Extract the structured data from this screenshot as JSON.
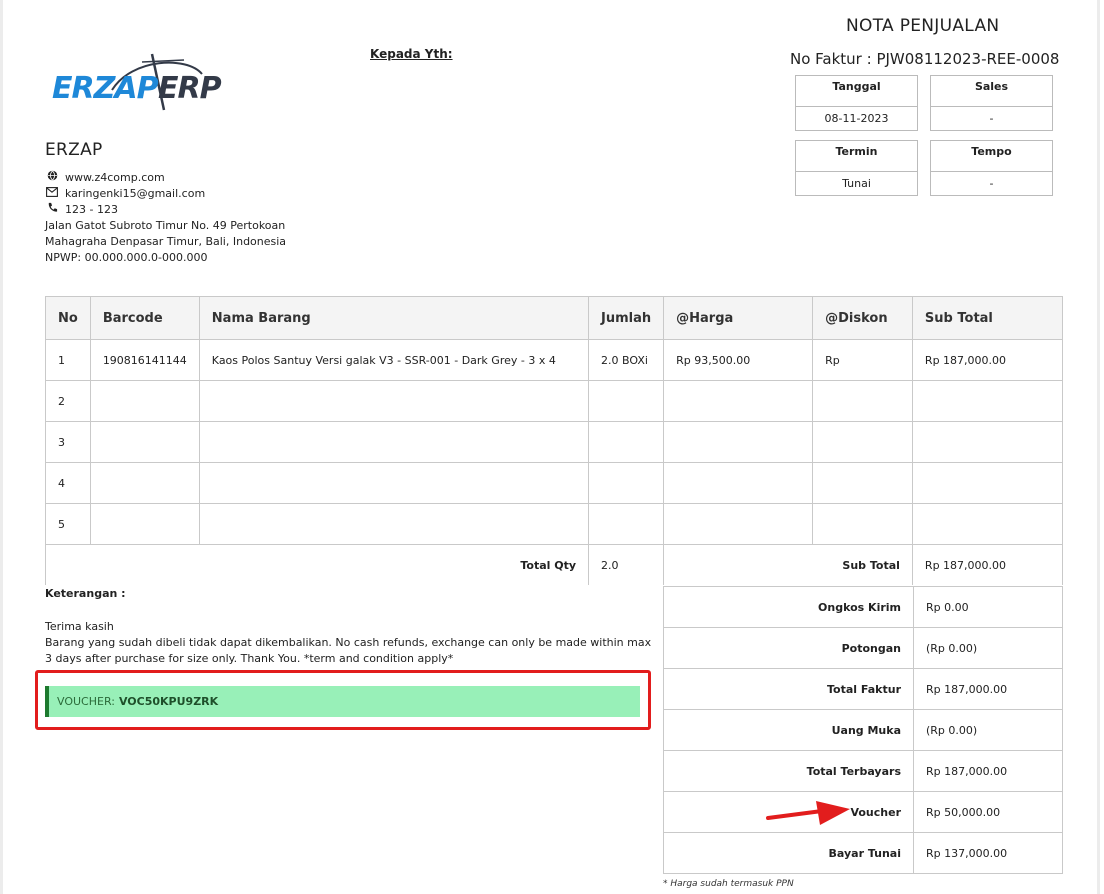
{
  "header": {
    "kepada_label": "Kepada Yth:",
    "title": "NOTA PENJUALAN",
    "no_faktur": "No Faktur : PJW08112023-REE-0008",
    "logo_text": "ERZAPERP"
  },
  "company": {
    "name": "ERZAP",
    "website": "www.z4comp.com",
    "email": "karingenki15@gmail.com",
    "phone": "123 - 123",
    "address_line1": "Jalan Gatot Subroto Timur No. 49 Pertokoan",
    "address_line2": "Mahagraha Denpasar Timur, Bali, Indonesia",
    "npwp": "NPWP: 00.000.000.0-000.000"
  },
  "meta": {
    "tanggal_label": "Tanggal",
    "tanggal_value": "08-11-2023",
    "sales_label": "Sales",
    "sales_value": "-",
    "termin_label": "Termin",
    "termin_value": "Tunai",
    "tempo_label": "Tempo",
    "tempo_value": "-"
  },
  "table": {
    "headers": [
      "No",
      "Barcode",
      "Nama Barang",
      "Jumlah",
      "@Harga",
      "@Diskon",
      "Sub Total"
    ],
    "rows": [
      [
        "1",
        "190816141144",
        "Kaos Polos Santuy Versi galak V3 - SSR-001 - Dark Grey - 3 x 4",
        "2.0 BOXi",
        "Rp 93,500.00",
        "Rp",
        "Rp 187,000.00"
      ],
      [
        "2",
        "",
        "",
        "",
        "",
        "",
        ""
      ],
      [
        "3",
        "",
        "",
        "",
        "",
        "",
        ""
      ],
      [
        "4",
        "",
        "",
        "",
        "",
        "",
        ""
      ],
      [
        "5",
        "",
        "",
        "",
        "",
        "",
        ""
      ]
    ],
    "total_qty_label": "Total Qty",
    "total_qty_value": "2.0",
    "sub_total_label": "Sub Total",
    "sub_total_value": "Rp 187,000.00"
  },
  "keterangan": {
    "label": "Keterangan :",
    "line1": "Terima kasih",
    "line2": "Barang yang sudah dibeli tidak dapat dikembalikan. No cash refunds, exchange can only be made within max 3 days after purchase for size only. Thank You. *term and condition apply*"
  },
  "voucher": {
    "label": "VOUCHER:",
    "code": "VOC50KPU9ZRK"
  },
  "summary": [
    {
      "label": "Ongkos Kirim",
      "value": "Rp 0.00"
    },
    {
      "label": "Potongan",
      "value": "(Rp 0.00)"
    },
    {
      "label": "Total Faktur",
      "value": "Rp 187,000.00"
    },
    {
      "label": "Uang Muka",
      "value": "(Rp 0.00)"
    },
    {
      "label": "Total Terbayars",
      "value": "Rp 187,000.00"
    },
    {
      "label": "Voucher",
      "value": "Rp 50,000.00"
    },
    {
      "label": "Bayar Tunai",
      "value": "Rp 137,000.00"
    }
  ],
  "footnote": "* Harga sudah termasuk PPN",
  "colors": {
    "highlight_frame": "#e21d1d",
    "voucher_bg": "#98f0b8",
    "logo_blue": "#1e88d8",
    "logo_dark": "#333a48"
  }
}
